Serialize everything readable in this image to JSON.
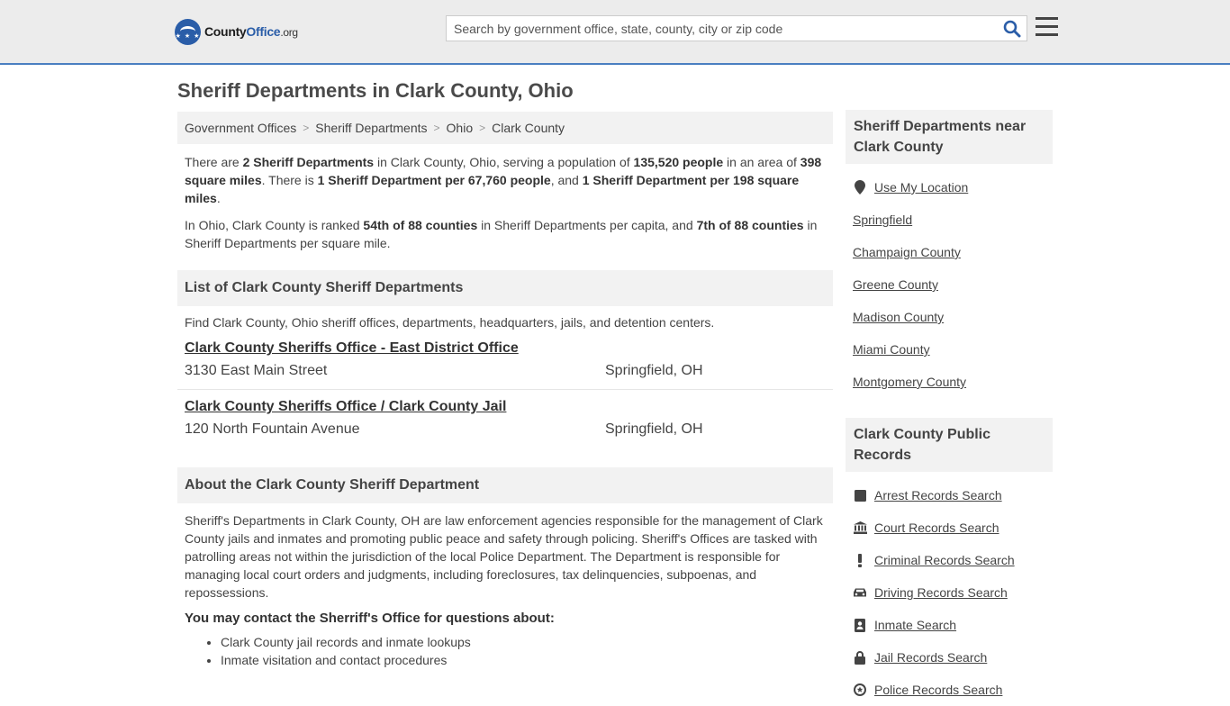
{
  "brand": {
    "name_part1": "County",
    "name_part2": "Office",
    "name_suffix": ".org"
  },
  "search": {
    "placeholder": "Search by government office, state, county, city or zip code"
  },
  "page": {
    "title": "Sheriff Departments in Clark County, Ohio"
  },
  "breadcrumb": [
    "Government Offices",
    "Sheriff Departments",
    "Ohio",
    "Clark County"
  ],
  "intro": {
    "p1": {
      "a": "There are ",
      "b": "2 Sheriff Departments",
      "c": " in Clark County, Ohio, serving a population of ",
      "d": "135,520 people",
      "e": " in an area of ",
      "f": "398 square miles",
      "g": ". There is ",
      "h": "1 Sheriff Department per 67,760 people",
      "i": ", and ",
      "j": "1 Sheriff Department per 198 square miles",
      "k": "."
    },
    "p2": {
      "a": "In Ohio, Clark County is ranked ",
      "b": "54th of 88 counties",
      "c": " in Sheriff Departments per capita, and ",
      "d": "7th of 88 counties",
      "e": " in Sheriff Departments per square mile."
    }
  },
  "list": {
    "heading": "List of Clark County Sheriff Departments",
    "intro": "Find Clark County, Ohio sheriff offices, departments, headquarters, jails, and detention centers.",
    "offices": [
      {
        "name": "Clark County Sheriffs Office - East District Office",
        "address": "3130 East Main Street",
        "city": "Springfield, OH"
      },
      {
        "name": "Clark County Sheriffs Office / Clark County Jail",
        "address": "120 North Fountain Avenue",
        "city": "Springfield, OH"
      }
    ]
  },
  "about": {
    "heading": "About the Clark County Sheriff Department",
    "text": "Sheriff's Departments in Clark County, OH are law enforcement agencies responsible for the management of Clark County jails and inmates and promoting public peace and safety through policing. Sheriff's Offices are tasked with patrolling areas not within the jurisdiction of the local Police Department. The Department is responsible for managing local court orders and judgments, including foreclosures, tax delinquencies, subpoenas, and repossessions.",
    "contact_heading": "You may contact the Sherriff's Office for questions about:",
    "bullets": [
      "Clark County jail records and inmate lookups",
      "Inmate visitation and contact procedures"
    ]
  },
  "sidebar": {
    "nearby_heading": "Sheriff Departments near Clark County",
    "use_location": "Use My Location",
    "nearby": [
      "Springfield",
      "Champaign County",
      "Greene County",
      "Madison County",
      "Miami County",
      "Montgomery County"
    ],
    "records_heading": "Clark County Public Records",
    "records": [
      {
        "label": "Arrest Records Search",
        "icon": "square-icon"
      },
      {
        "label": "Court Records Search",
        "icon": "courthouse-icon"
      },
      {
        "label": "Criminal Records Search",
        "icon": "exclamation-icon"
      },
      {
        "label": "Driving Records Search",
        "icon": "car-icon"
      },
      {
        "label": "Inmate Search",
        "icon": "id-card-icon"
      },
      {
        "label": "Jail Records Search",
        "icon": "lock-icon"
      },
      {
        "label": "Police Records Search",
        "icon": "police-icon"
      }
    ]
  },
  "colors": {
    "accent": "#2a5da8",
    "header_bg": "#ececec",
    "panel_bg": "#f2f2f2"
  }
}
